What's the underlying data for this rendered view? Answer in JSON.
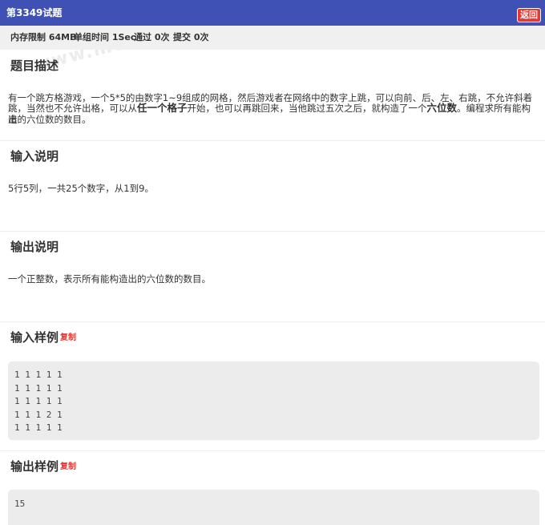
{
  "header": {
    "title": "第3349试题",
    "back_label": "返回"
  },
  "stats": {
    "memory": "内存限制 64MB",
    "time": "单组时间 1Sec",
    "passed": "通过 0次",
    "submitted": "提交 0次"
  },
  "watermark": "www.mokit.top",
  "description": {
    "heading": "题目描述",
    "line1": "有一个跳方格游戏，一个5*5的由数字1~9组成的网格，然后游戏者在网络中的数字上跳，可以向前、后、左、右跳，不允许斜着",
    "line2_a": "跳，当然也不允许出格，可以从",
    "line2_bold1": "任一个格子",
    "line2_b": "开始，也可以再跳回来，当他跳过五次之后，就构造了一个",
    "line2_bold2": "六位数",
    "line2_c": "。编程求所有能构造",
    "line3": "出的六位数的数目。"
  },
  "input_desc": {
    "heading": "输入说明",
    "text": "5行5列，一共25个数字，从1到9。"
  },
  "output_desc": {
    "heading": "输出说明",
    "text": "一个正整数，表示所有能构造出的六位数的数目。"
  },
  "sample_input": {
    "heading": "输入样例",
    "copy_label": "复制",
    "lines": [
      "1 1 1 1 1",
      "1 1 1 1 1",
      "1 1 1 1 1",
      "1 1 1 2 1",
      "1 1 1 1 1"
    ]
  },
  "sample_output": {
    "heading": "输出样例",
    "copy_label": "复制",
    "lines": [
      "15"
    ]
  }
}
